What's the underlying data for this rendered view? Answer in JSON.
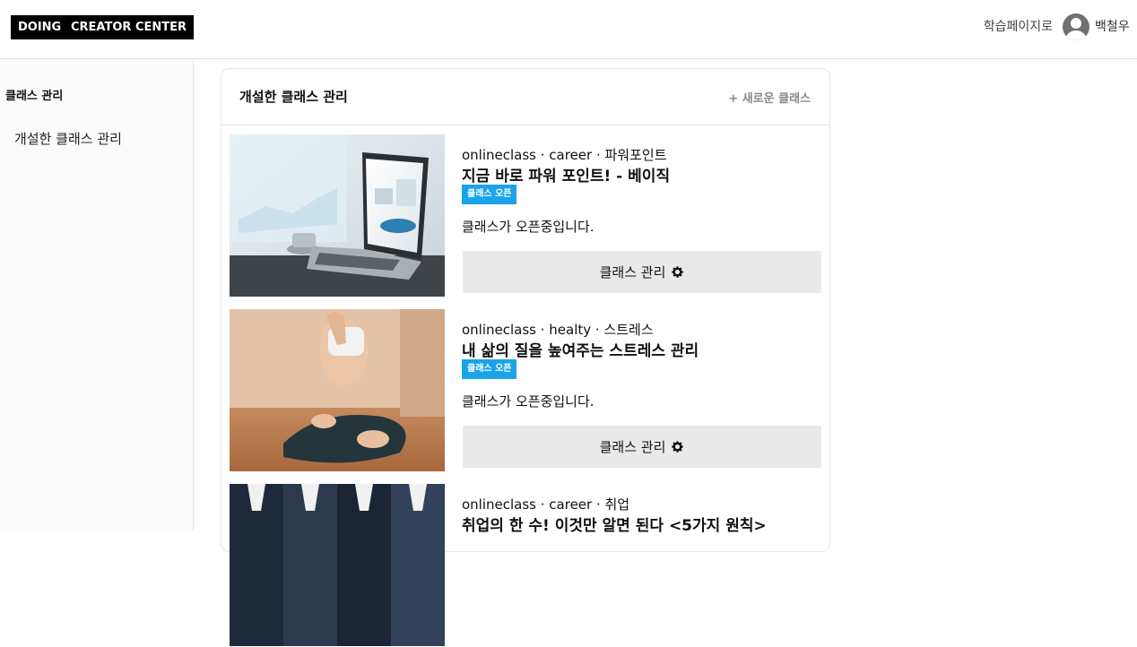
{
  "header": {
    "logo_doing": "DOING",
    "logo_creator": "CREATOR CENTER",
    "learning_page_link": "학습페이지로",
    "username": "백철우"
  },
  "sidebar": {
    "section_title": "클래스 관리",
    "items": [
      {
        "label": "개설한 클래스 관리"
      }
    ]
  },
  "main": {
    "title": "개설한 클래스 관리",
    "new_class_label": "+ 새로운 클래스",
    "classes": [
      {
        "category": "onlineclass · career · 파워포인트",
        "title": "지금 바로 파워 포인트! - 베이직",
        "badge": "클래스 오픈",
        "status": "클래스가 오픈중입니다.",
        "manage_label": "클래스 관리",
        "thumbnail": "laptop-photo"
      },
      {
        "category": "onlineclass · healty · 스트레스",
        "title": "내 삶의 질을 높여주는 스트레스 관리",
        "badge": "클래스 오픈",
        "status": "클래스가 오픈중입니다.",
        "manage_label": "클래스 관리",
        "thumbnail": "yoga-photo"
      },
      {
        "category": "onlineclass · career · 취업",
        "title": "취업의 한 수! 이것만 알면 된다 <5가지 원칙>",
        "thumbnail": "interview-photo"
      }
    ]
  },
  "icons": {
    "manage": "gear-icon",
    "avatar": "user-avatar-icon"
  }
}
